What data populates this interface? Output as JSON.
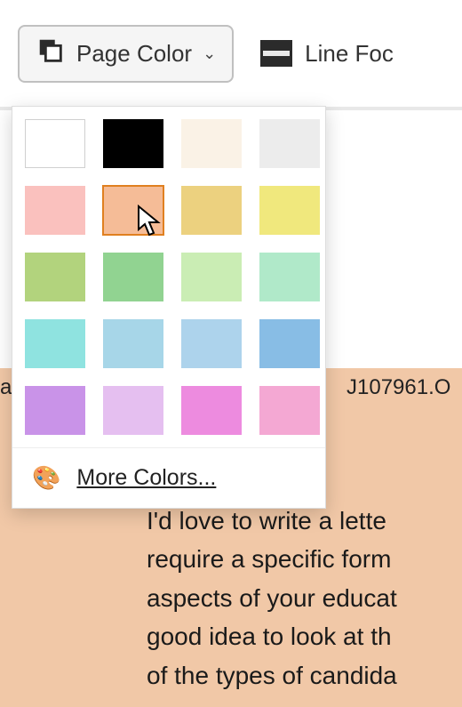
{
  "toolbar": {
    "page_color_label": "Page Color",
    "line_focus_label": "Line Foc"
  },
  "dropdown": {
    "swatches": [
      {
        "color": "#ffffff",
        "name": "white",
        "selected": false
      },
      {
        "color": "#000000",
        "name": "black",
        "selected": false
      },
      {
        "color": "#faf2e6",
        "name": "cream",
        "selected": false
      },
      {
        "color": "#ececec",
        "name": "light-gray",
        "selected": false
      },
      {
        "color": "#fac1be",
        "name": "pink",
        "selected": false
      },
      {
        "color": "#f5bc97",
        "name": "peach",
        "selected": true
      },
      {
        "color": "#ecd17f",
        "name": "mustard",
        "selected": false
      },
      {
        "color": "#f0e87d",
        "name": "yellow",
        "selected": false
      },
      {
        "color": "#b2d37d",
        "name": "olive",
        "selected": false
      },
      {
        "color": "#91d391",
        "name": "green",
        "selected": false
      },
      {
        "color": "#caedb4",
        "name": "light-green",
        "selected": false
      },
      {
        "color": "#b0e9c9",
        "name": "mint",
        "selected": false
      },
      {
        "color": "#8fe3e0",
        "name": "teal",
        "selected": false
      },
      {
        "color": "#a7d6e8",
        "name": "sky",
        "selected": false
      },
      {
        "color": "#add3ec",
        "name": "light-blue",
        "selected": false
      },
      {
        "color": "#88bde5",
        "name": "blue",
        "selected": false
      },
      {
        "color": "#c993e8",
        "name": "purple",
        "selected": false
      },
      {
        "color": "#e5bff0",
        "name": "lavender",
        "selected": false
      },
      {
        "color": "#ed8bdf",
        "name": "magenta",
        "selected": false
      },
      {
        "color": "#f4a8d3",
        "name": "rose",
        "selected": false
      }
    ],
    "more_colors_label": "More Colors..."
  },
  "document": {
    "code_left": "a",
    "code_right": "J107961.O",
    "body_lines": [
      "I'd love to write a lette",
      "require a specific form",
      "aspects of your educat",
      "good idea to look at th",
      "of the types of candida"
    ]
  }
}
